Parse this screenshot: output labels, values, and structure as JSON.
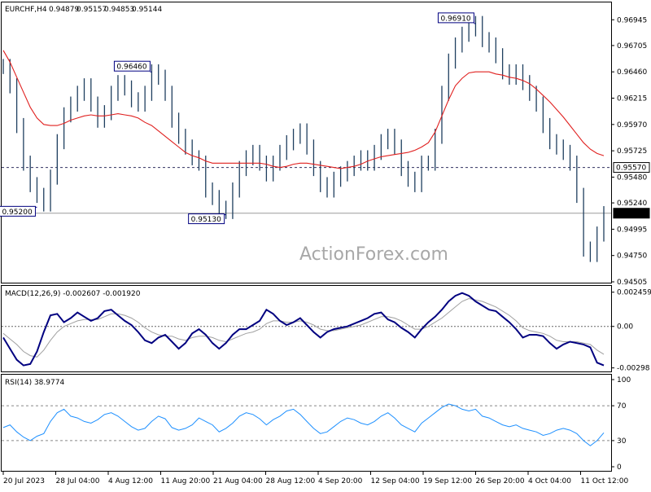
{
  "header": {
    "symbol": "EURCHF,H4",
    "open": "0.94879",
    "high": "0.95157",
    "low": "0.94853",
    "close": "0.95144"
  },
  "watermark": "ActionForex.com",
  "colors": {
    "price": "#1f3f5f",
    "ma": "#e0201f",
    "macd": "#000080",
    "macd_signal": "#a0a0a0",
    "rsi": "#1e90ff",
    "dashed": "#303060"
  },
  "chart_data": [
    {
      "type": "line",
      "title": "EURCHF,H4 0.94879 0.95157 0.94853 0.95144",
      "ylim": [
        0.94505,
        0.97
      ],
      "y_ticks": [
        "0.96945",
        "0.96705",
        "0.96460",
        "0.96215",
        "0.95970",
        "0.95725",
        "0.95480",
        "0.95240",
        "0.94995",
        "0.94750",
        "0.94505"
      ],
      "x_ticks": [
        "20 Jul 2023",
        "28 Jul 04:00",
        "4 Aug 12:00",
        "11 Aug 20:00",
        "21 Aug 04:00",
        "28 Aug 12:00",
        "4 Sep 20:00",
        "12 Sep 04:00",
        "19 Sep 12:00",
        "26 Sep 20:00",
        "4 Oct 04:00",
        "11 Oct 12:00"
      ],
      "annotations": [
        {
          "label": "0.95200",
          "value": 0.952
        },
        {
          "label": "0.96460",
          "value": 0.9646
        },
        {
          "label": "0.95130",
          "value": 0.9513
        },
        {
          "label": "0.96910",
          "value": 0.9691
        }
      ],
      "horizontal_lines": [
        {
          "label": "0.95570",
          "value": 0.9557,
          "style": "dashed"
        },
        {
          "label": "0.95144",
          "value": 0.95144,
          "style": "solid"
        }
      ],
      "series": [
        {
          "values": [
            0.9651,
            0.9633,
            0.9596,
            0.9561,
            0.9541,
            0.9531,
            0.9523,
            0.9548,
            0.9581,
            0.9606,
            0.9616,
            0.9626,
            0.9633,
            0.9616,
            0.9601,
            0.9608,
            0.9626,
            0.9636,
            0.9631,
            0.962,
            0.9616,
            0.9626,
            0.9646,
            0.9641,
            0.9626,
            0.9601,
            0.9586,
            0.9576,
            0.9566,
            0.9561,
            0.9536,
            0.9529,
            0.9519,
            0.9516,
            0.9536,
            0.9556,
            0.9566,
            0.9571,
            0.9561,
            0.9551,
            0.9561,
            0.9571,
            0.958,
            0.9586,
            0.9591,
            0.9576,
            0.9556,
            0.9541,
            0.9536,
            0.9546,
            0.9551,
            0.9556,
            0.9561,
            0.9566,
            0.9561,
            0.9571,
            0.9581,
            0.9586,
            0.9576,
            0.9556,
            0.9546,
            0.9541,
            0.9561,
            0.9561,
            0.9586,
            0.9626,
            0.9656,
            0.9671,
            0.9681,
            0.9686,
            0.9691,
            0.9676,
            0.9671,
            0.9661,
            0.9646,
            0.9641,
            0.9646,
            0.9636,
            0.9626,
            0.9616,
            0.9596,
            0.9581,
            0.9576,
            0.9571,
            0.9561,
            0.9531,
            0.9481,
            0.9476,
            0.9495,
            0.9514
          ],
          "ma": [
            0.9666,
            0.9655,
            0.9641,
            0.9627,
            0.9613,
            0.9603,
            0.9597,
            0.9596,
            0.9596,
            0.9598,
            0.9601,
            0.9603,
            0.9605,
            0.9606,
            0.9605,
            0.9605,
            0.9606,
            0.9607,
            0.9606,
            0.9605,
            0.9603,
            0.9599,
            0.9596,
            0.9591,
            0.9586,
            0.9581,
            0.9576,
            0.9571,
            0.9568,
            0.9566,
            0.9563,
            0.9561,
            0.9561,
            0.9561,
            0.9561,
            0.9561,
            0.9561,
            0.9561,
            0.9561,
            0.956,
            0.9558,
            0.9557,
            0.9558,
            0.956,
            0.9561,
            0.9561,
            0.956,
            0.9559,
            0.9558,
            0.9557,
            0.9556,
            0.9557,
            0.9558,
            0.956,
            0.9563,
            0.9565,
            0.9567,
            0.9568,
            0.9569,
            0.957,
            0.9571,
            0.9573,
            0.9576,
            0.958,
            0.959,
            0.9605,
            0.962,
            0.9633,
            0.964,
            0.9645,
            0.9646,
            0.9646,
            0.9646,
            0.9644,
            0.9643,
            0.9641,
            0.964,
            0.9638,
            0.9635,
            0.963,
            0.9624,
            0.9618,
            0.9611,
            0.9604,
            0.9596,
            0.9588,
            0.958,
            0.9574,
            0.957,
            0.9568
          ]
        }
      ]
    },
    {
      "type": "line",
      "title": "MACD(12,26,9) -0.002607 -0.001920",
      "ylim": [
        -0.003,
        0.0025
      ],
      "y_ticks": [
        "0.002459",
        "0.00",
        "-0.00298"
      ],
      "series": [
        {
          "name": "MACD",
          "values": [
            -0.0008,
            -0.0016,
            -0.0024,
            -0.0028,
            -0.0027,
            -0.0018,
            -0.0004,
            0.0008,
            0.0009,
            0.0003,
            0.0006,
            0.001,
            0.0007,
            0.0004,
            0.0006,
            0.0011,
            0.0012,
            0.0008,
            0.0004,
            0.0001,
            -0.0004,
            -0.001,
            -0.0012,
            -0.0008,
            -0.0006,
            -0.0011,
            -0.0016,
            -0.0012,
            -0.0005,
            -0.0002,
            -0.0006,
            -0.0012,
            -0.0016,
            -0.0012,
            -0.0006,
            -0.0002,
            -0.0002,
            0.0001,
            0.0004,
            0.0012,
            0.0009,
            0.0004,
            0.0001,
            0.0003,
            0.0006,
            0.0001,
            -0.0004,
            -0.0008,
            -0.0004,
            -0.0002,
            -0.0001,
            0.0,
            0.0002,
            0.0004,
            0.0006,
            0.0009,
            0.001,
            0.0005,
            0.0003,
            -0.0001,
            -0.0004,
            -0.0008,
            -0.0002,
            0.0003,
            0.0007,
            0.0012,
            0.0018,
            0.0022,
            0.0024,
            0.0022,
            0.0018,
            0.0015,
            0.0012,
            0.0011,
            0.0007,
            0.0003,
            -0.0002,
            -0.0008,
            -0.0006,
            -0.0006,
            -0.0007,
            -0.0012,
            -0.0016,
            -0.0013,
            -0.0011,
            -0.0012,
            -0.0013,
            -0.0015,
            -0.0026,
            -0.0028
          ]
        },
        {
          "name": "Signal",
          "values": [
            -0.0005,
            -0.0009,
            -0.0013,
            -0.0018,
            -0.0021,
            -0.0022,
            -0.0017,
            -0.001,
            -0.0004,
            0.0,
            0.0002,
            0.0004,
            0.0005,
            0.0005,
            0.0005,
            0.0007,
            0.0009,
            0.0009,
            0.0008,
            0.0006,
            0.0003,
            -0.0001,
            -0.0004,
            -0.0006,
            -0.0007,
            -0.0007,
            -0.0009,
            -0.001,
            -0.0008,
            -0.0007,
            -0.0007,
            -0.0008,
            -0.001,
            -0.0011,
            -0.0009,
            -0.0007,
            -0.0005,
            -0.0004,
            -0.0002,
            0.0002,
            0.0004,
            0.0004,
            0.0003,
            0.0003,
            0.0004,
            0.0003,
            0.0001,
            -0.0002,
            -0.0003,
            -0.0003,
            -0.0002,
            -0.0001,
            0.0,
            0.0001,
            0.0003,
            0.0005,
            0.0007,
            0.0007,
            0.0006,
            0.0004,
            0.0001,
            -0.0002,
            -0.0002,
            0.0,
            0.0003,
            0.0006,
            0.001,
            0.0014,
            0.0018,
            0.002,
            0.0019,
            0.0018,
            0.0016,
            0.0014,
            0.0011,
            0.0008,
            0.0004,
            -0.0001,
            -0.0003,
            -0.0004,
            -0.0005,
            -0.0007,
            -0.001,
            -0.0011,
            -0.0011,
            -0.0011,
            -0.0012,
            -0.0013,
            -0.0017,
            -0.002
          ]
        }
      ]
    },
    {
      "type": "line",
      "title": "RSI(14) 38.9774",
      "ylim": [
        0,
        100
      ],
      "y_ticks": [
        "100",
        "70",
        "30",
        "0"
      ],
      "levels": [
        70,
        30
      ],
      "series": [
        {
          "name": "RSI",
          "values": [
            45,
            48,
            40,
            34,
            30,
            35,
            38,
            52,
            62,
            66,
            58,
            56,
            52,
            50,
            54,
            60,
            62,
            58,
            52,
            46,
            42,
            44,
            52,
            58,
            55,
            45,
            42,
            44,
            48,
            56,
            52,
            48,
            40,
            44,
            50,
            58,
            62,
            60,
            55,
            48,
            54,
            58,
            64,
            66,
            60,
            52,
            44,
            38,
            40,
            46,
            52,
            56,
            54,
            50,
            48,
            52,
            58,
            62,
            56,
            48,
            44,
            40,
            50,
            56,
            62,
            68,
            72,
            70,
            66,
            64,
            66,
            58,
            56,
            52,
            48,
            46,
            48,
            44,
            42,
            40,
            36,
            38,
            42,
            44,
            42,
            38,
            30,
            24,
            30,
            39
          ]
        }
      ]
    }
  ]
}
